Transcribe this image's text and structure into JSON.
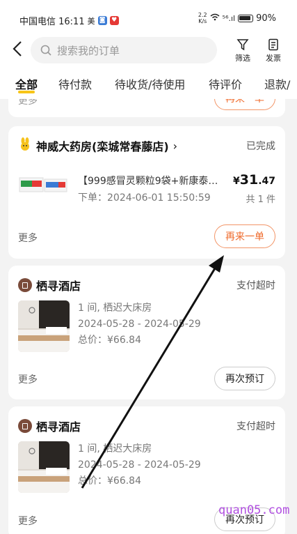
{
  "status_bar": {
    "carrier_time": "中国电信 16:11",
    "badge1": "美",
    "speed": "2.2\nK/s",
    "signal": "⁵⁶.ıl",
    "battery": "90%"
  },
  "header": {
    "search_placeholder": "搜索我的订单",
    "filter_label": "筛选",
    "invoice_label": "发票"
  },
  "tabs": [
    "全部",
    "待付款",
    "待收货/待使用",
    "待评价",
    "退款/"
  ],
  "top_partial_card": {
    "more": "更多",
    "button": "再来一单"
  },
  "pharmacy_order": {
    "store": "神威大药房(栾城常春藤店)",
    "status": "已完成",
    "title": "【999感冒灵颗粒9袋+新康泰…",
    "order_time": "下单：2024-06-01 15:50:59",
    "price_symbol": "¥",
    "price_int": "31",
    "price_dec": ".47",
    "count": "共 1 件",
    "more": "更多",
    "button": "再来一单"
  },
  "hotel_orders": [
    {
      "store": "栖寻酒店",
      "status": "支付超时",
      "room": "1 间, 栖迟大床房",
      "dates": "2024-05-28 - 2024-05-29",
      "total": "总价：¥66.84",
      "more": "更多",
      "button": "再次预订"
    },
    {
      "store": "栖寻酒店",
      "status": "支付超时",
      "room": "1 间, 栖迟大床房",
      "dates": "2024-05-28 - 2024-05-29",
      "total": "总价：¥66.84",
      "more": "更多",
      "button": "再次预订"
    }
  ],
  "watermark": "quan05.com",
  "colors": {
    "accent": "#f7c518",
    "orange": "#ef6a2b"
  }
}
